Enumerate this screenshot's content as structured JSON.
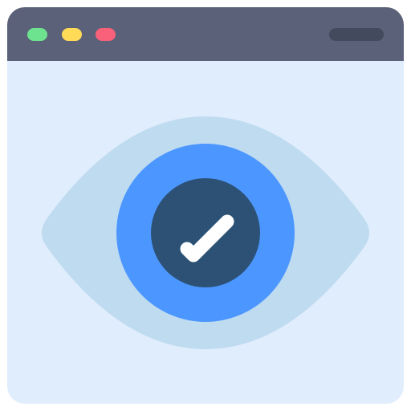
{
  "colors": {
    "titlebar": "#5A6178",
    "background": "#E0EDFD",
    "dot_green": "#6EE38F",
    "dot_yellow": "#FFDB58",
    "dot_red": "#F9617A",
    "address_bar": "#434A5E",
    "eye_outer": "#BFDBF0",
    "iris": "#4C97FF",
    "pupil": "#2C5175",
    "checkmark": "#FFFFFF"
  },
  "icons": {
    "window_controls": [
      "green-dot-icon",
      "yellow-dot-icon",
      "red-dot-icon"
    ],
    "main": "eye-icon",
    "status": "checkmark-icon"
  }
}
